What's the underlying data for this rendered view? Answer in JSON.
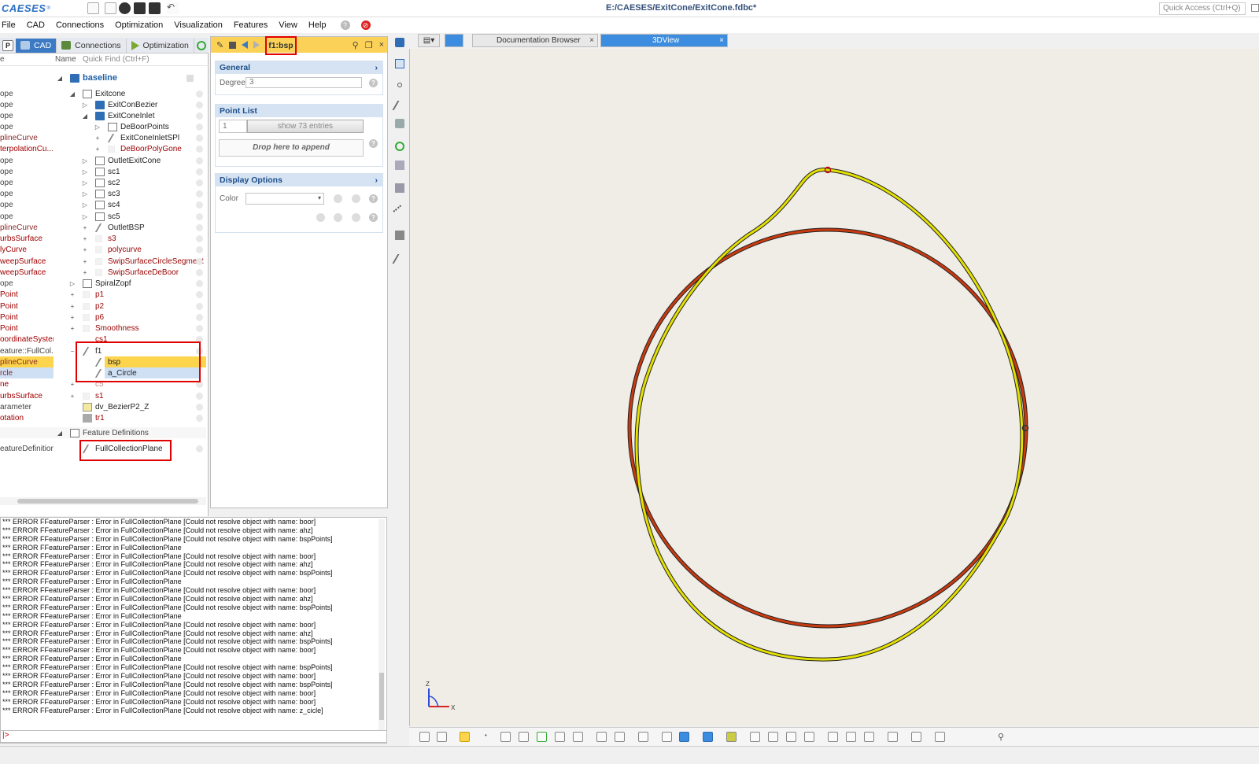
{
  "app": {
    "logo_text": "CAESES",
    "logo_sup": "®",
    "document_title": "E:/CAESES/ExitCone/ExitCone.fdbc*",
    "quick_access_placeholder": "Quick Access (Ctrl+Q)"
  },
  "menu": [
    "File",
    "CAD",
    "Connections",
    "Optimization",
    "Visualization",
    "Features",
    "View",
    "Help"
  ],
  "left_tabs": {
    "p_label": "P",
    "cad": "CAD",
    "connections": "Connections",
    "optimization": "Optimization"
  },
  "tree_header": {
    "type_col": "e",
    "name_col": "Name",
    "quick_find": "Quick Find (Ctrl+F)"
  },
  "tree": [
    {
      "type": "",
      "name": "baseline",
      "style": "root"
    },
    {
      "type": "ope",
      "name": "Exitcone"
    },
    {
      "type": "ope",
      "name": "ExitConBezier"
    },
    {
      "type": "ope",
      "name": "ExitConeInlet"
    },
    {
      "type": "ope",
      "name": "DeBoorPoints"
    },
    {
      "type": "plineCurve",
      "name": "ExitConeInletSPl"
    },
    {
      "type": "terpolationCu...",
      "name": "DeBoorPolyGone"
    },
    {
      "type": "ope",
      "name": "OutletExitCone"
    },
    {
      "type": "ope",
      "name": "sc1"
    },
    {
      "type": "ope",
      "name": "sc2"
    },
    {
      "type": "ope",
      "name": "sc3"
    },
    {
      "type": "ope",
      "name": "sc4"
    },
    {
      "type": "ope",
      "name": "sc5"
    },
    {
      "type": "plineCurve",
      "name": "OutletBSP"
    },
    {
      "type": "urbsSurface",
      "name": "s3"
    },
    {
      "type": "lyCurve",
      "name": "polycurve"
    },
    {
      "type": "weepSurface",
      "name": "SwipSurfaceCircleSegment"
    },
    {
      "type": "weepSurface",
      "name": "SwipSurfaceDeBoor"
    },
    {
      "type": "ope",
      "name": "SpiralZopf"
    },
    {
      "type": "Point",
      "name": "p1"
    },
    {
      "type": "Point",
      "name": "p2"
    },
    {
      "type": "Point",
      "name": "p6"
    },
    {
      "type": "Point",
      "name": "Smoothness"
    },
    {
      "type": "oordinateSystem",
      "name": "cs1"
    },
    {
      "type": "eature::FullCol...",
      "name": "f1"
    },
    {
      "type": "plineCurve",
      "name": "bsp"
    },
    {
      "type": "rcle",
      "name": "a_Circle"
    },
    {
      "type": "ne",
      "name": "c5"
    },
    {
      "type": "urbsSurface",
      "name": "s1"
    },
    {
      "type": "arameter",
      "name": "dv_BezierP2_Z"
    },
    {
      "type": "otation",
      "name": "tr1"
    },
    {
      "type": "",
      "name": "Feature Definitions"
    },
    {
      "type": "eatureDefinition",
      "name": "FullCollectionPlane"
    }
  ],
  "props": {
    "title": "f1:bsp",
    "general_title": "General",
    "degree_label": "Degree",
    "degree_value": "3",
    "point_list_title": "Point List",
    "point_list_index": "1",
    "show_entries": "show 73 entries",
    "drop_hint": "Drop here to append",
    "display_options_title": "Display Options",
    "color_label": "Color"
  },
  "console_lines": [
    "*** ERROR FFeatureParser : Error in FullCollectionPlane [Could not resolve object with name: boor]",
    "*** ERROR FFeatureParser : Error in FullCollectionPlane [Could not resolve object with name: ahz]",
    "*** ERROR FFeatureParser : Error in FullCollectionPlane [Could not resolve object with name: bspPoints]",
    "*** ERROR FFeatureParser : Error in FullCollectionPlane",
    "*** ERROR FFeatureParser : Error in FullCollectionPlane [Could not resolve object with name: boor]",
    "*** ERROR FFeatureParser : Error in FullCollectionPlane [Could not resolve object with name: ahz]",
    "*** ERROR FFeatureParser : Error in FullCollectionPlane [Could not resolve object with name: bspPoints]",
    "*** ERROR FFeatureParser : Error in FullCollectionPlane",
    "*** ERROR FFeatureParser : Error in FullCollectionPlane [Could not resolve object with name: boor]",
    "*** ERROR FFeatureParser : Error in FullCollectionPlane [Could not resolve object with name: ahz]",
    "*** ERROR FFeatureParser : Error in FullCollectionPlane [Could not resolve object with name: bspPoints]",
    "*** ERROR FFeatureParser : Error in FullCollectionPlane",
    "*** ERROR FFeatureParser : Error in FullCollectionPlane [Could not resolve object with name: boor]",
    "*** ERROR FFeatureParser : Error in FullCollectionPlane [Could not resolve object with name: ahz]",
    "*** ERROR FFeatureParser : Error in FullCollectionPlane [Could not resolve object with name: bspPoints]",
    "*** ERROR FFeatureParser : Error in FullCollectionPlane [Could not resolve object with name: boor]",
    "*** ERROR FFeatureParser : Error in FullCollectionPlane",
    "*** ERROR FFeatureParser : Error in FullCollectionPlane [Could not resolve object with name: bspPoints]",
    "*** ERROR FFeatureParser : Error in FullCollectionPlane [Could not resolve object with name: boor]",
    "*** ERROR FFeatureParser : Error in FullCollectionPlane [Could not resolve object with name: bspPoints]",
    "*** ERROR FFeatureParser : Error in FullCollectionPlane [Could not resolve object with name: boor]",
    "*** ERROR FFeatureParser : Error in FullCollectionPlane [Could not resolve object with name: boor]",
    "*** ERROR FFeatureParser : Error in FullCollectionPlane [Could not resolve object with name: z_cicle]"
  ],
  "command_prompt": "|>",
  "doc_tabs": {
    "documentation": "Documentation Browser",
    "view3d": "3DView"
  },
  "colors": {
    "accent_blue": "#3c7bc4",
    "selection_yellow": "#fcd54c",
    "highlight_red": "#e00000",
    "curve_yellow": "#e4e000",
    "curve_red": "#c83a10",
    "viewport_bg": "#efede6"
  }
}
